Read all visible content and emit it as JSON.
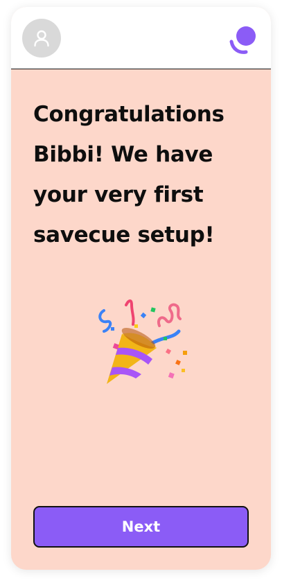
{
  "header": {
    "avatar_icon": "user-icon",
    "logo_icon": "savecue-logo-icon",
    "brand_color": "#8b5cf6"
  },
  "main": {
    "message": "Congratulations Bibbi! We have your very first savecue setup!",
    "illustration": "party-popper-icon",
    "background_color": "#fdd7ca"
  },
  "actions": {
    "next_label": "Next"
  }
}
